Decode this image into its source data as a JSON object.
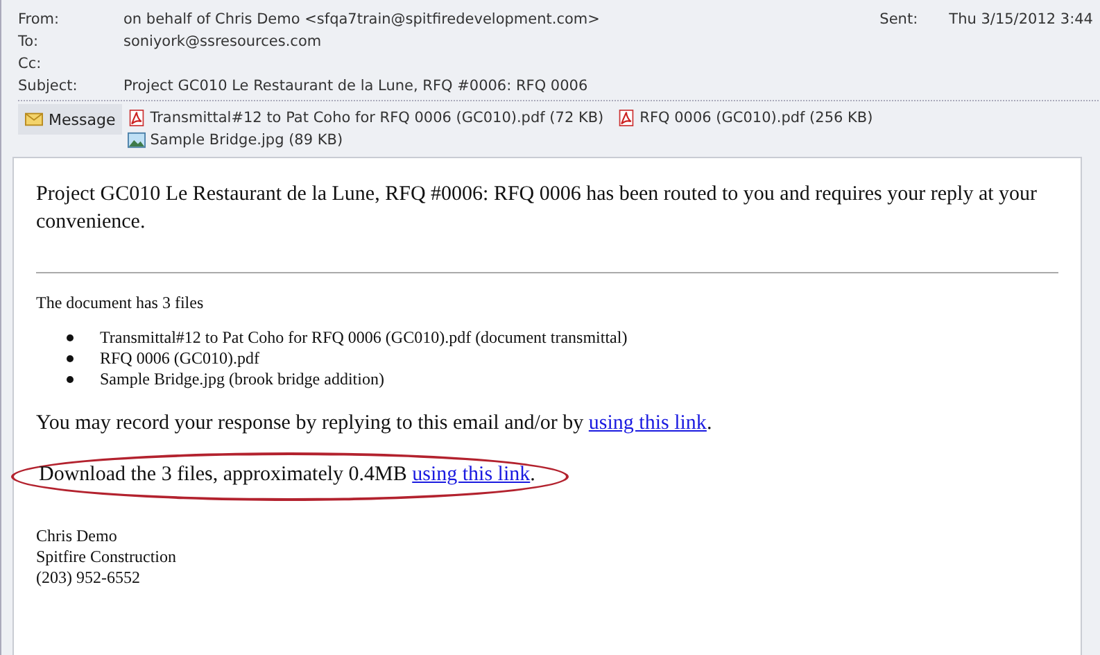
{
  "header": {
    "fields": [
      {
        "label": "From:",
        "value": "on behalf of Chris Demo <sfqa7train@spitfiredevelopment.com>"
      },
      {
        "label": "To:",
        "value": "soniyork@ssresources.com"
      },
      {
        "label": "Cc:"
      },
      {
        "label": "Subject:",
        "value": "Project GC010 Le Restaurant de la Lune, RFQ #0006: RFQ 0006"
      }
    ],
    "sent": {
      "label": "Sent:",
      "value": "Thu 3/15/2012 3:44"
    }
  },
  "message_tab": {
    "label": "Message",
    "selected": true
  },
  "attachments": [
    {
      "kind": "pdf",
      "name": "Transmittal#12 to Pat Coho  for RFQ 0006 (GC010).pdf (72 KB)"
    },
    {
      "kind": "pdf",
      "name": "RFQ 0006 (GC010).pdf (256 KB)"
    },
    {
      "kind": "image",
      "name": "Sample Bridge.jpg (89 KB)"
    }
  ],
  "body": {
    "intro": "Project GC010 Le Restaurant de la Lune, RFQ #0006: RFQ 0006 has been routed to you and requires your reply at your convenience.",
    "files_heading": "The document has 3 files",
    "files": [
      "Transmittal#12 to Pat Coho for RFQ 0006 (GC010).pdf (document transmittal)",
      "RFQ 0006 (GC010).pdf",
      "Sample Bridge.jpg (brook bridge addition)"
    ],
    "paragraphs": [
      {
        "text": "You may record your response by replying to this email and/or by ",
        "link": "using this link",
        "after": ".",
        "highlighted": false
      },
      {
        "text": "Download the 3 files, approximately 0.4MB ",
        "link": "using this link",
        "after": ".",
        "highlighted": true
      }
    ],
    "signature": [
      "Chris Demo",
      "Spitfire Construction",
      "(203) 952-6552"
    ]
  }
}
